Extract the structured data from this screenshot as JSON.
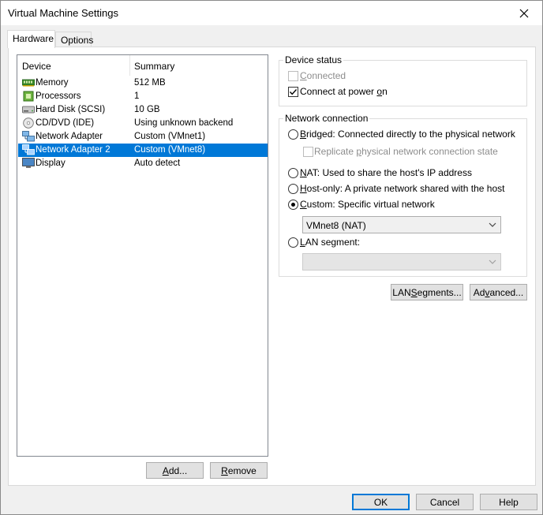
{
  "window": {
    "title": "Virtual Machine Settings"
  },
  "tabs": [
    {
      "label": "Hardware",
      "active": true
    },
    {
      "label": "Options",
      "active": false
    }
  ],
  "device_list": {
    "columns": [
      "Device",
      "Summary"
    ],
    "rows": [
      {
        "icon": "memory-icon",
        "device": "Memory",
        "summary": "512 MB"
      },
      {
        "icon": "processor-icon",
        "device": "Processors",
        "summary": "1"
      },
      {
        "icon": "hard-disk-icon",
        "device": "Hard Disk (SCSI)",
        "summary": "10 GB"
      },
      {
        "icon": "cd-dvd-icon",
        "device": "CD/DVD (IDE)",
        "summary": "Using unknown backend"
      },
      {
        "icon": "network-adapter-icon",
        "device": "Network Adapter",
        "summary": "Custom (VMnet1)"
      },
      {
        "icon": "network-adapter-icon",
        "device": "Network Adapter 2",
        "summary": "Custom (VMnet8)",
        "selected": true
      },
      {
        "icon": "display-icon",
        "device": "Display",
        "summary": "Auto detect"
      }
    ]
  },
  "list_buttons": {
    "add": {
      "prefix": "",
      "mnemonic": "A",
      "suffix": "dd..."
    },
    "remove": {
      "prefix": "",
      "mnemonic": "R",
      "suffix": "emove"
    }
  },
  "device_status": {
    "title": "Device status",
    "connected": {
      "prefix": "",
      "mnemonic": "C",
      "suffix": "onnected",
      "checked": false,
      "enabled": false
    },
    "connect_power_on": {
      "prefix": "Connect at power ",
      "mnemonic": "o",
      "suffix": "n",
      "checked": true,
      "enabled": true
    }
  },
  "network_connection": {
    "title": "Network connection",
    "bridged": {
      "prefix": "",
      "mnemonic": "B",
      "suffix": "ridged: Connected directly to the physical network",
      "selected": false
    },
    "replicate": {
      "prefix": "Replicate ",
      "mnemonic": "p",
      "suffix": "hysical network connection state",
      "checked": false,
      "enabled": false
    },
    "nat": {
      "prefix": "",
      "mnemonic": "N",
      "suffix": "AT: Used to share the host's IP address",
      "selected": false
    },
    "host_only": {
      "prefix": "",
      "mnemonic": "H",
      "suffix": "ost-only: A private network shared with the host",
      "selected": false
    },
    "custom": {
      "prefix": "",
      "mnemonic": "C",
      "suffix": "ustom: Specific virtual network",
      "selected": true
    },
    "custom_network_value": "VMnet8 (NAT)",
    "lan_segment": {
      "prefix": "",
      "mnemonic": "L",
      "suffix": "AN segment:",
      "selected": false
    },
    "lan_segment_value": ""
  },
  "net_buttons": {
    "lan_segments": {
      "prefix": "LAN ",
      "mnemonic": "S",
      "suffix": "egments..."
    },
    "advanced": {
      "prefix": "Ad",
      "mnemonic": "v",
      "suffix": "anced..."
    }
  },
  "dialog_buttons": {
    "ok": "OK",
    "cancel": "Cancel",
    "help": "Help"
  },
  "colors": {
    "selection": "#0078d7",
    "window_bg": "#f0f0f0",
    "panel_bg": "#ffffff"
  }
}
